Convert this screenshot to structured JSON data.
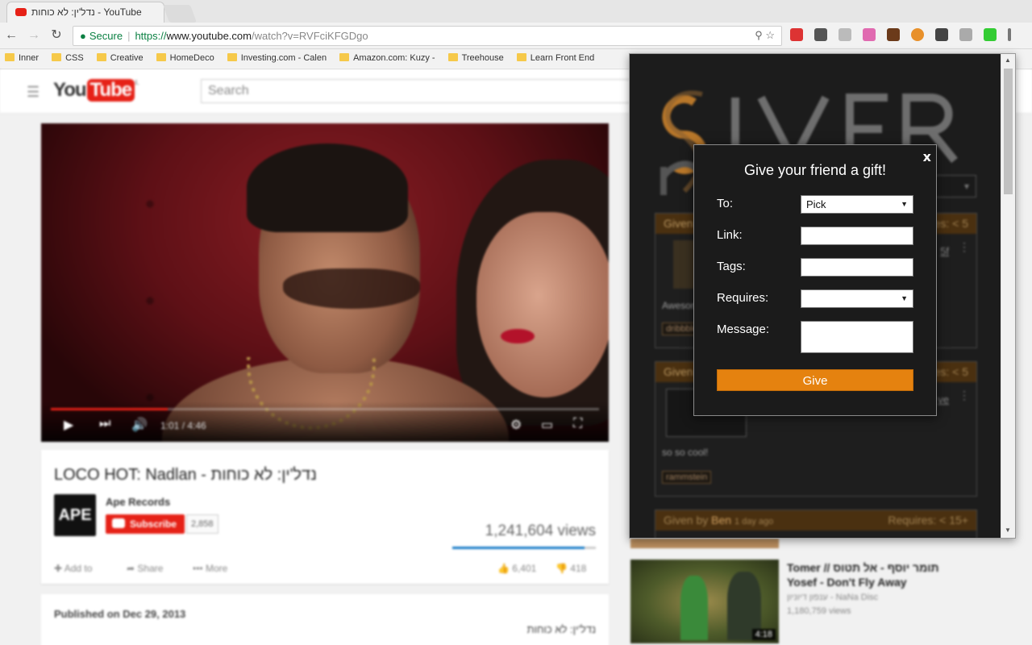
{
  "browser": {
    "tab_title": "נדל'ין: לא כוחות - YouTube",
    "secure_label": "Secure",
    "url_scheme": "https://",
    "url_host": "www.youtube.com",
    "url_path": "/watch?v=RVFciKFGDgo",
    "bookmarks": [
      "Inner",
      "CSS",
      "Creative",
      "HomeDeco",
      "Investing.com - Calen",
      "Amazon.com: Kuzy - ",
      "Treehouse",
      "Learn Front End"
    ]
  },
  "youtube": {
    "logo_you": "You",
    "logo_tube": "Tube",
    "logo_locale": "IL",
    "search_placeholder": "Search",
    "player": {
      "time": "1:01 / 4:46",
      "progress": 0.213
    },
    "video_title": "LOCO HOT: Nadlan - נדל'ין: לא כוחות",
    "channel_name": "Ape Records",
    "channel_avatar_text": "APE",
    "subscribe_label": "Subscribe",
    "subscriber_count": "2,858",
    "views": "1,241,604 views",
    "like_ratio": 0.92,
    "actions": {
      "add_to": "Add to",
      "share": "Share",
      "more": "More",
      "likes": "6,401",
      "dislikes": "418"
    },
    "published": "Published on Dec 29, 2013",
    "description": "נדל'ין: לא כוחות",
    "recommended": {
      "title_line1": "Tomer // תומר יוסף - אל תטוס",
      "title_line2": "Yosef - Don't Fly Away",
      "channel": "ענפון דיוניון - NaNa Disc",
      "views": "1,180,759 views",
      "duration": "4:18"
    }
  },
  "giver": {
    "logo_text": "GIVER",
    "cards": [
      {
        "given_by": "Given",
        "requires": "Requires: < 5",
        "desc": "Awesome",
        "tag": "dribbble"
      },
      {
        "given_by": "Given",
        "requires": "Requires: < 5",
        "desc": "so so cool!",
        "tag": "rammstein"
      },
      {
        "given_prefix": "Given by ",
        "given_name": "Ben",
        "given_time": "1 day ago",
        "requires": "Requires: < 15+"
      }
    ],
    "modal": {
      "close_label": "x",
      "title": "Give your friend a gift!",
      "to_label": "To:",
      "to_value": "Pick",
      "link_label": "Link:",
      "link_value": "",
      "tags_label": "Tags:",
      "tags_value": "",
      "requires_label": "Requires:",
      "requires_value": "",
      "message_label": "Message:",
      "message_value": "",
      "give_label": "Give"
    }
  },
  "colors": {
    "accent_orange": "#e5820f",
    "youtube_red": "#e62117",
    "popup_bg": "#1c1c1c"
  }
}
